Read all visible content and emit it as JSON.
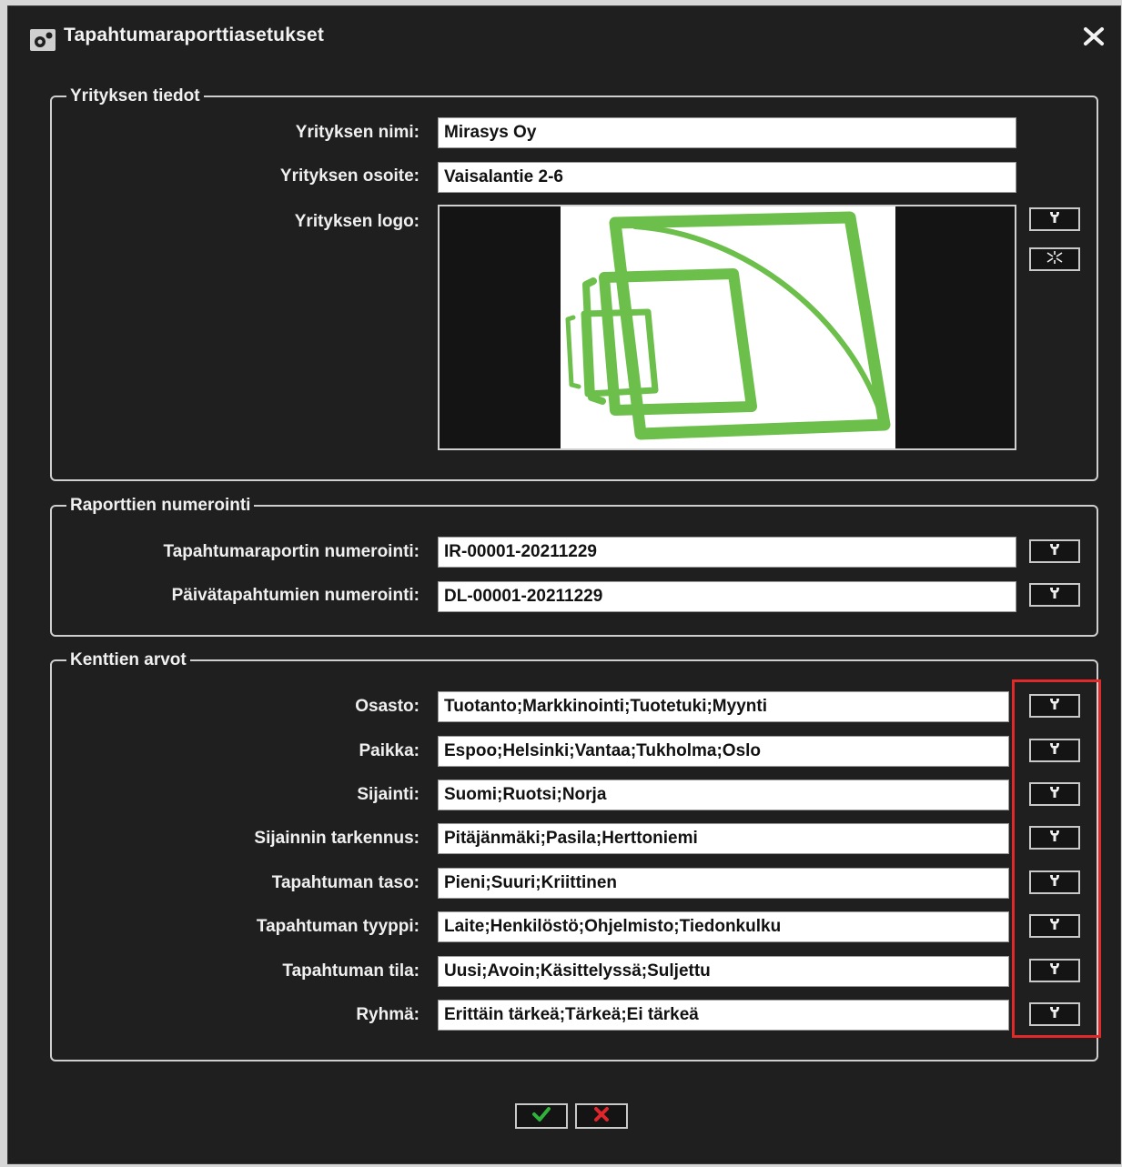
{
  "window": {
    "title": "Tapahtumaraporttiasetukset"
  },
  "company": {
    "legend": "Yrityksen tiedot",
    "name_label": "Yrityksen nimi:",
    "name_value": "Mirasys Oy",
    "address_label": "Yrityksen osoite:",
    "address_value": "Vaisalantie 2-6",
    "logo_label": "Yrityksen logo:"
  },
  "numbering": {
    "legend": "Raporttien numerointi",
    "rows": [
      {
        "label": "Tapahtumaraportin numerointi:",
        "value": "IR-00001-20211229"
      },
      {
        "label": "Päivätapahtumien numerointi:",
        "value": "DL-00001-20211229"
      }
    ]
  },
  "fields": {
    "legend": "Kenttien arvot",
    "rows": [
      {
        "label": "Osasto:",
        "value": "Tuotanto;Markkinointi;Tuotetuki;Myynti"
      },
      {
        "label": "Paikka:",
        "value": "Espoo;Helsinki;Vantaa;Tukholma;Oslo"
      },
      {
        "label": "Sijainti:",
        "value": "Suomi;Ruotsi;Norja"
      },
      {
        "label": "Sijainnin tarkennus:",
        "value": "Pitäjänmäki;Pasila;Herttoniemi"
      },
      {
        "label": "Tapahtuman taso:",
        "value": "Pieni;Suuri;Kriittinen"
      },
      {
        "label": "Tapahtuman tyyppi:",
        "value": "Laite;Henkilöstö;Ohjelmisto;Tiedonkulku"
      },
      {
        "label": "Tapahtuman tila:",
        "value": "Uusi;Avoin;Käsittelyssä;Suljettu"
      },
      {
        "label": "Ryhmä:",
        "value": "Erittäin tärkeä;Tärkeä;Ei tärkeä"
      }
    ]
  },
  "icons": {
    "title": "settings-icon",
    "close": "close-icon",
    "edit": "wrench-icon",
    "clear": "clear-icon",
    "ok": "checkmark-icon",
    "cancel": "cross-icon"
  },
  "colors": {
    "window_bg": "#1f1f1f",
    "logo_green": "#6cbf4a",
    "ok_green": "#2fb33a",
    "cancel_red": "#e0262a",
    "highlight_red": "#e02a2a"
  }
}
